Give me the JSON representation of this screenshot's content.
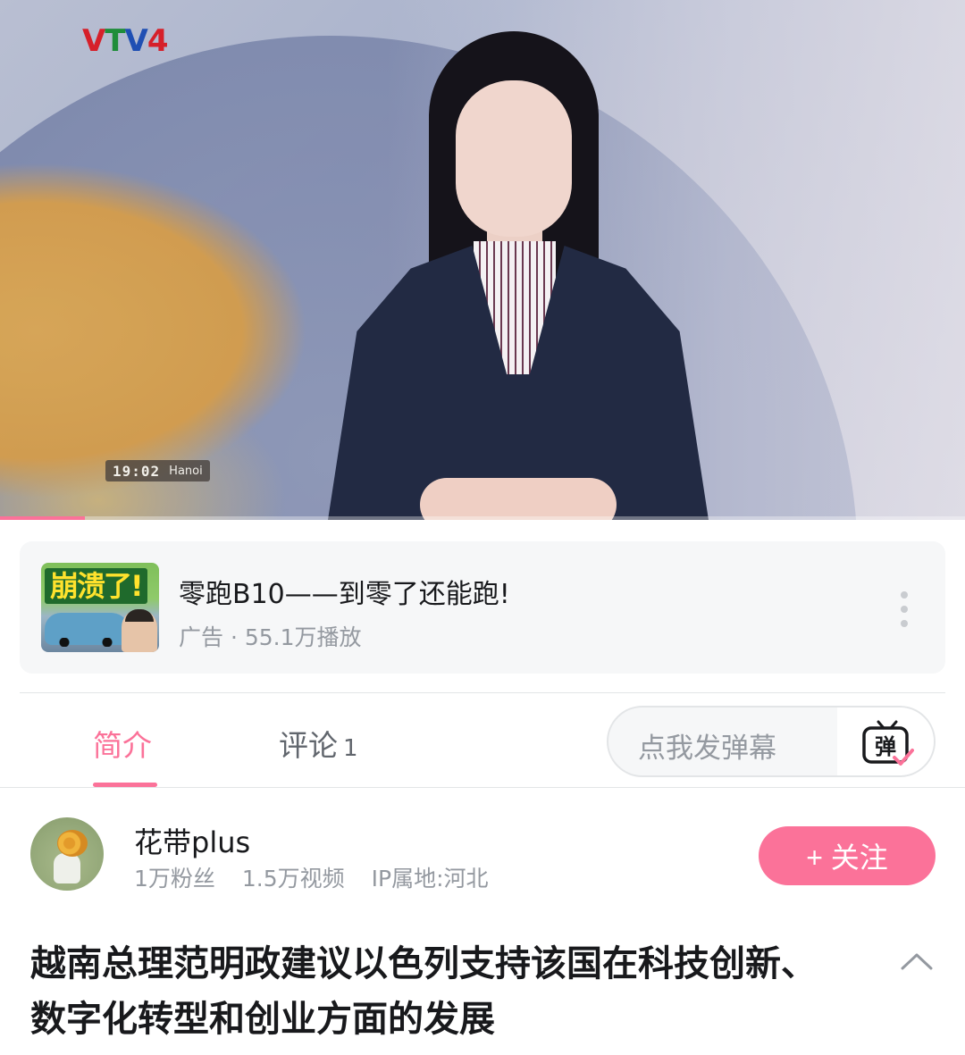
{
  "player": {
    "channel_logo_text": "VTV4",
    "clock_time": "19:02",
    "clock_city": "Hanoi",
    "progress_fraction": 0.088
  },
  "ad": {
    "thumbnail_text": "崩溃了!",
    "title": "零跑B10——到零了还能跑!",
    "meta": "广告 · 55.1万播放",
    "more_icon": "more-vertical-icon"
  },
  "tabs": {
    "intro": "简介",
    "comments": "评论",
    "comments_count": "1",
    "active": "intro"
  },
  "danmaku": {
    "placeholder": "点我发弹幕",
    "icon_text": "弹",
    "icon": "danmaku-tv-icon"
  },
  "uploader": {
    "name": "花带plus",
    "followers": "1万粉丝",
    "videos": "1.5万视频",
    "ip_location": "IP属地:河北",
    "follow_label": "+ 关注"
  },
  "video": {
    "title": "越南总理范明政建议以色列支持该国在科技创新、数字化转型和创业方面的发展",
    "collapse_icon": "chevron-up-icon"
  },
  "colors": {
    "accent": "#fb7299",
    "text_primary": "#18191c",
    "text_secondary": "#9499a0",
    "card_bg": "#f6f7f8"
  }
}
